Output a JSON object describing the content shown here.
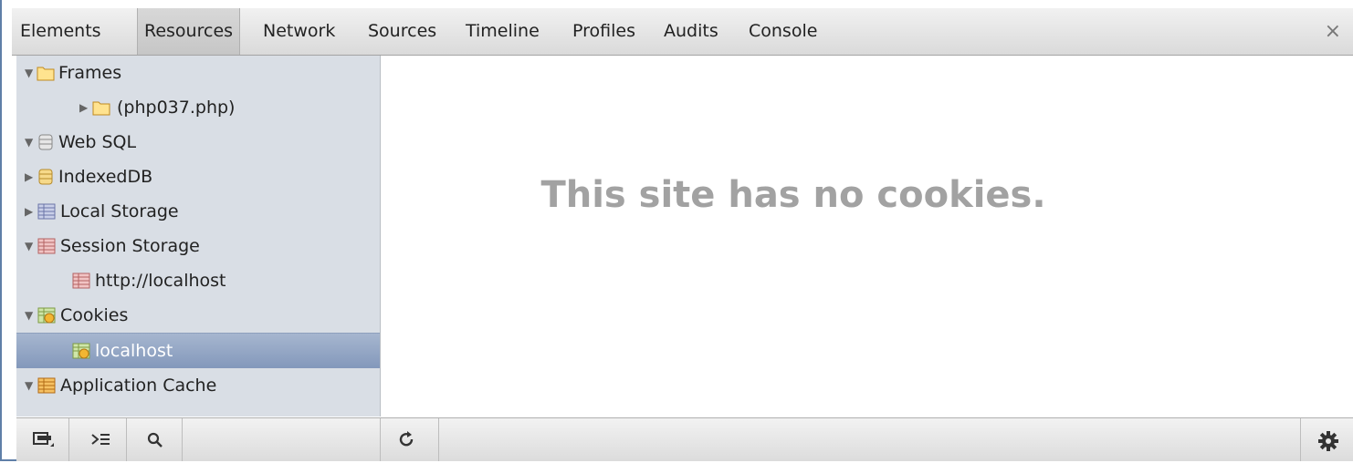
{
  "tabs": [
    {
      "label": "Elements",
      "selected": false
    },
    {
      "label": "Resources",
      "selected": true
    },
    {
      "label": "Network",
      "selected": false
    },
    {
      "label": "Sources",
      "selected": false
    },
    {
      "label": "Timeline",
      "selected": false
    },
    {
      "label": "Profiles",
      "selected": false
    },
    {
      "label": "Audits",
      "selected": false
    },
    {
      "label": "Console",
      "selected": false
    }
  ],
  "close_glyph": "×",
  "tree": [
    {
      "label": "Frames",
      "icon": "folder-icon",
      "expanded": true
    },
    {
      "label": "(php037.php)",
      "icon": "folder-icon",
      "expanded": false
    },
    {
      "label": "Web SQL",
      "icon": "database-icon",
      "expanded": true
    },
    {
      "label": "IndexedDB",
      "icon": "database-icon",
      "expanded": false
    },
    {
      "label": "Local Storage",
      "icon": "table-icon",
      "expanded": false
    },
    {
      "label": "Session Storage",
      "icon": "table-icon",
      "expanded": true
    },
    {
      "label": "http://localhost",
      "icon": "table-icon"
    },
    {
      "label": "Cookies",
      "icon": "cookie-icon",
      "expanded": true
    },
    {
      "label": "localhost",
      "icon": "cookie-icon",
      "selected": true
    },
    {
      "label": "Application Cache",
      "icon": "table-icon",
      "expanded": true
    }
  ],
  "main": {
    "message": "This site has no cookies."
  },
  "colors": {
    "selected_row": "#8398bb",
    "sidebar_bg": "#d9dee5",
    "message": "#a2a2a2",
    "frame_border": "#5f7fa8"
  }
}
